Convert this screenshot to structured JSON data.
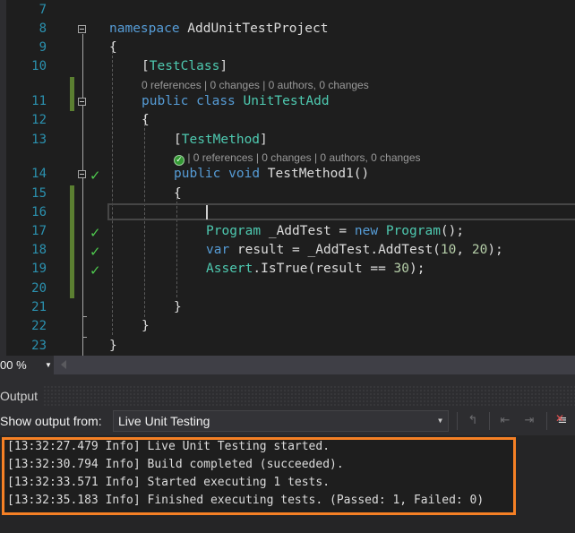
{
  "editor": {
    "lines": [
      {
        "n": "7"
      },
      {
        "n": "8"
      },
      {
        "n": "9"
      },
      {
        "n": "10"
      },
      {
        "n": "11"
      },
      {
        "n": "12"
      },
      {
        "n": "13"
      },
      {
        "n": "14"
      },
      {
        "n": "15"
      },
      {
        "n": "16"
      },
      {
        "n": "17"
      },
      {
        "n": "18"
      },
      {
        "n": "19"
      },
      {
        "n": "20"
      },
      {
        "n": "21"
      },
      {
        "n": "22"
      },
      {
        "n": "23"
      }
    ],
    "code": {
      "l8_kw": "namespace",
      "l8_name": " AddUnitTestProject",
      "l9": "{",
      "l10_open": "[",
      "l10_attr": "TestClass",
      "l10_close": "]",
      "l11_lens": "0 references | 0 changes | 0 authors, 0 changes",
      "l11_kw1": "public",
      "l11_kw2": "class",
      "l11_name": "UnitTestAdd",
      "l12": "{",
      "l13_open": "[",
      "l13_attr": "TestMethod",
      "l13_close": "]",
      "l14_lens": " | 0 references | 0 changes | 0 authors, 0 changes",
      "l14_lens_icon": "✓",
      "l14_kw1": "public",
      "l14_kw2": "void",
      "l14_name": " TestMethod1()",
      "l15": "{",
      "l17_type": "Program",
      "l17_mid": " _AddTest = ",
      "l17_kw": "new",
      "l17_type2": "Program",
      "l17_end": "();",
      "l18_kw": "var",
      "l18_mid": " result = _AddTest.AddTest(",
      "l18_n1": "10",
      "l18_sep": ", ",
      "l18_n2": "20",
      "l18_end": ");",
      "l19_type": "Assert",
      "l19_mid": ".IsTrue(result == ",
      "l19_n": "30",
      "l19_end": ");",
      "l21": "}",
      "l22": "}",
      "l23": "}"
    },
    "test_status_icon": "✓"
  },
  "zoom_bar": {
    "zoom_value": "00 %",
    "dropdown_icon": "▼"
  },
  "output": {
    "title": "Output",
    "show_output_label": "Show output from:",
    "source_selected": "Live Unit Testing",
    "dropdown_icon": "▼",
    "toolbar": {
      "find_in_output_icon": "↰",
      "prev_message_icon": "⇤",
      "next_message_icon": "⇥",
      "clear_all_icon": "≡",
      "clear_x_icon": "✕"
    },
    "log": [
      "[13:32:27.479 Info] Live Unit Testing started.",
      "[13:32:30.794 Info] Build completed (succeeded).",
      "[13:32:33.571 Info] Started executing 1 tests.",
      "[13:32:35.183 Info] Finished executing tests. (Passed: 1, Failed: 0)"
    ],
    "highlight_color": "#f58025"
  }
}
